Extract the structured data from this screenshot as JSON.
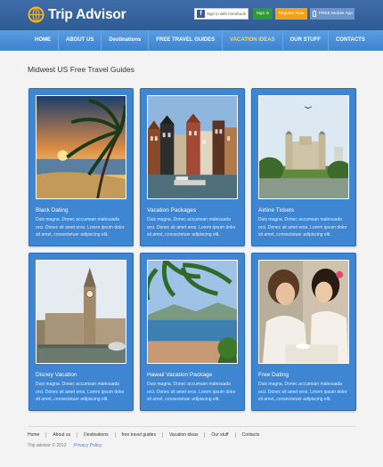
{
  "header": {
    "logo_text": "Trip Advisor",
    "facebook_label": "Sign in with Facebook",
    "signin_label": "Sign in",
    "register_label": "Register Now",
    "mobile_label": "FREE Mobile App"
  },
  "nav": {
    "items": [
      {
        "label": "HOME"
      },
      {
        "label": "ABOUT US"
      },
      {
        "label": "Destinations"
      },
      {
        "label": "FREE TRAVEL GUIDES"
      },
      {
        "label": "VACATION IDEAS"
      },
      {
        "label": "OUR STUFF"
      },
      {
        "label": "CONTACTS"
      }
    ],
    "active_index": 4
  },
  "main": {
    "title": "Midwest US Free Travel Guides",
    "cards": [
      {
        "title": "Black Dating",
        "text": "Duis magna. Donec accumsan malesuada orci. Donec sit amet eros. Lorem ipsum dolor sit amet, consectetuer adipiscing elit."
      },
      {
        "title": "Vacation Packages",
        "text": "Duis magna. Donec accumsan malesuada orci. Donec sit amet eros. Lorem ipsum dolor sit amet, consectetuer adipiscing elit."
      },
      {
        "title": "Airline Tickets",
        "text": "Duis magna. Donec accumsan malesuada orci. Donec sit amet eros. Lorem ipsum dolor sit amet, consectetuer adipiscing elit."
      },
      {
        "title": "Disney Vacation",
        "text": "Duis magna. Donec accumsan malesuada orci. Donec sit amet eros. Lorem ipsum dolor sit amet, consectetuer adipiscing elit."
      },
      {
        "title": "Hawaii Vacation Package",
        "text": "Duis magna. Donec accumsan malesuada orci. Donec sit amet eros. Lorem ipsum dolor sit amet, consectetuer adipiscing elit."
      },
      {
        "title": "Free Dating",
        "text": "Duis magna. Donec accumsan malesuada orci. Donec sit amet eros. Lorem ipsum dolor sit amet, consectetuer adipiscing elit."
      }
    ]
  },
  "footer": {
    "links": [
      {
        "label": "Home"
      },
      {
        "label": "About us"
      },
      {
        "label": "Destinations"
      },
      {
        "label": "free travel guides"
      },
      {
        "label": "Vacation ideas"
      },
      {
        "label": "Our stuff"
      },
      {
        "label": "Contacts"
      }
    ],
    "copyright": "Trip advisor © 2012",
    "privacy": "Privacy Policy"
  },
  "colors": {
    "header": "#3f6da9",
    "nav": "#4a8fd8",
    "card": "#3e86d1",
    "active_nav": "#ffd95a",
    "signin": "#2e9a3c",
    "register": "#f2a21a"
  }
}
